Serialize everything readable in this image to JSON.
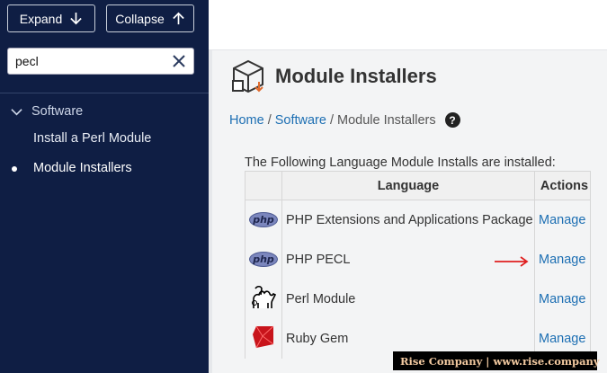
{
  "sidebar": {
    "expand_label": "Expand",
    "collapse_label": "Collapse",
    "search_value": "pecl",
    "section_label": "Software",
    "items": [
      {
        "label": "Install a Perl Module",
        "active": false
      },
      {
        "label": "Module Installers",
        "active": true
      }
    ]
  },
  "header": {
    "title": "Module Installers",
    "page_icon": "package-icon"
  },
  "breadcrumb": {
    "home": "Home",
    "sep": "/",
    "software": "Software",
    "current": "Module Installers",
    "help_icon": "help-icon"
  },
  "main": {
    "intro": "The Following Language Module Installs are installed:",
    "table": {
      "headers": [
        "",
        "Language",
        "Actions"
      ],
      "rows": [
        {
          "icon": "php-logo-icon",
          "language": "PHP Extensions and Applications Package",
          "action": "Manage"
        },
        {
          "icon": "php-logo-icon",
          "language": "PHP PECL",
          "action": "Manage"
        },
        {
          "icon": "camel-icon",
          "language": "Perl Module",
          "action": "Manage"
        },
        {
          "icon": "ruby-gem-icon",
          "language": "Ruby Gem",
          "action": "Manage"
        }
      ]
    },
    "php_badge_text": "php"
  },
  "watermark": {
    "text": "Rise Company | www.rise.company"
  },
  "colors": {
    "sidebar_bg": "#0f1e44",
    "link": "#1d6fb3",
    "annotation_arrow": "#e02020"
  }
}
